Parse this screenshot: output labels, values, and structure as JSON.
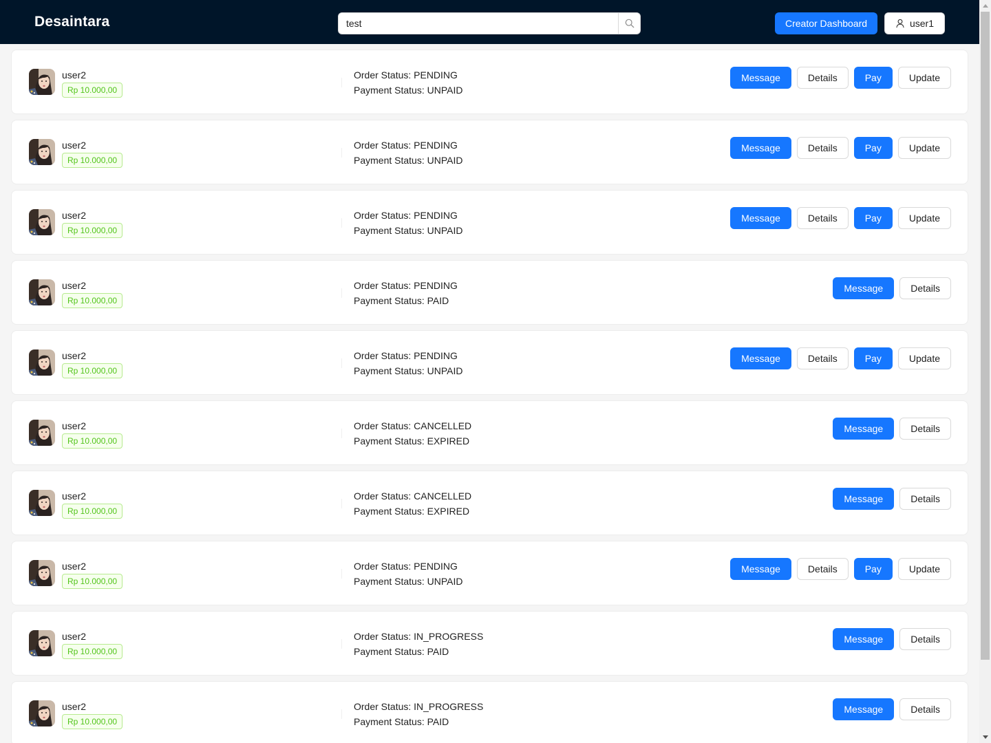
{
  "header": {
    "brand": "Desaintara",
    "search": {
      "value": "test"
    },
    "creator_dashboard_label": "Creator Dashboard",
    "user_label": "user1"
  },
  "orders": [
    {
      "user": "user2",
      "price": "Rp 10.000,00",
      "order_status": "Order Status: PENDING",
      "payment_status": "Payment Status: UNPAID",
      "actions": [
        "Message",
        "Details",
        "Pay",
        "Update"
      ]
    },
    {
      "user": "user2",
      "price": "Rp 10.000,00",
      "order_status": "Order Status: PENDING",
      "payment_status": "Payment Status: UNPAID",
      "actions": [
        "Message",
        "Details",
        "Pay",
        "Update"
      ]
    },
    {
      "user": "user2",
      "price": "Rp 10.000,00",
      "order_status": "Order Status: PENDING",
      "payment_status": "Payment Status: UNPAID",
      "actions": [
        "Message",
        "Details",
        "Pay",
        "Update"
      ]
    },
    {
      "user": "user2",
      "price": "Rp 10.000,00",
      "order_status": "Order Status: PENDING",
      "payment_status": "Payment Status: PAID",
      "actions": [
        "Message",
        "Details"
      ]
    },
    {
      "user": "user2",
      "price": "Rp 10.000,00",
      "order_status": "Order Status: PENDING",
      "payment_status": "Payment Status: UNPAID",
      "actions": [
        "Message",
        "Details",
        "Pay",
        "Update"
      ]
    },
    {
      "user": "user2",
      "price": "Rp 10.000,00",
      "order_status": "Order Status: CANCELLED",
      "payment_status": "Payment Status: EXPIRED",
      "actions": [
        "Message",
        "Details"
      ]
    },
    {
      "user": "user2",
      "price": "Rp 10.000,00",
      "order_status": "Order Status: CANCELLED",
      "payment_status": "Payment Status: EXPIRED",
      "actions": [
        "Message",
        "Details"
      ]
    },
    {
      "user": "user2",
      "price": "Rp 10.000,00",
      "order_status": "Order Status: PENDING",
      "payment_status": "Payment Status: UNPAID",
      "actions": [
        "Message",
        "Details",
        "Pay",
        "Update"
      ]
    },
    {
      "user": "user2",
      "price": "Rp 10.000,00",
      "order_status": "Order Status: IN_PROGRESS",
      "payment_status": "Payment Status: PAID",
      "actions": [
        "Message",
        "Details"
      ]
    },
    {
      "user": "user2",
      "price": "Rp 10.000,00",
      "order_status": "Order Status: IN_PROGRESS",
      "payment_status": "Payment Status: PAID",
      "actions": [
        "Message",
        "Details"
      ]
    }
  ],
  "icons": {
    "search": "search-icon",
    "user": "user-icon",
    "avatar": "avatar-image"
  },
  "colors": {
    "navbar": "#001529",
    "primary": "#1677ff",
    "price_tag": "#52c41a",
    "background": "#f5f5f5"
  }
}
